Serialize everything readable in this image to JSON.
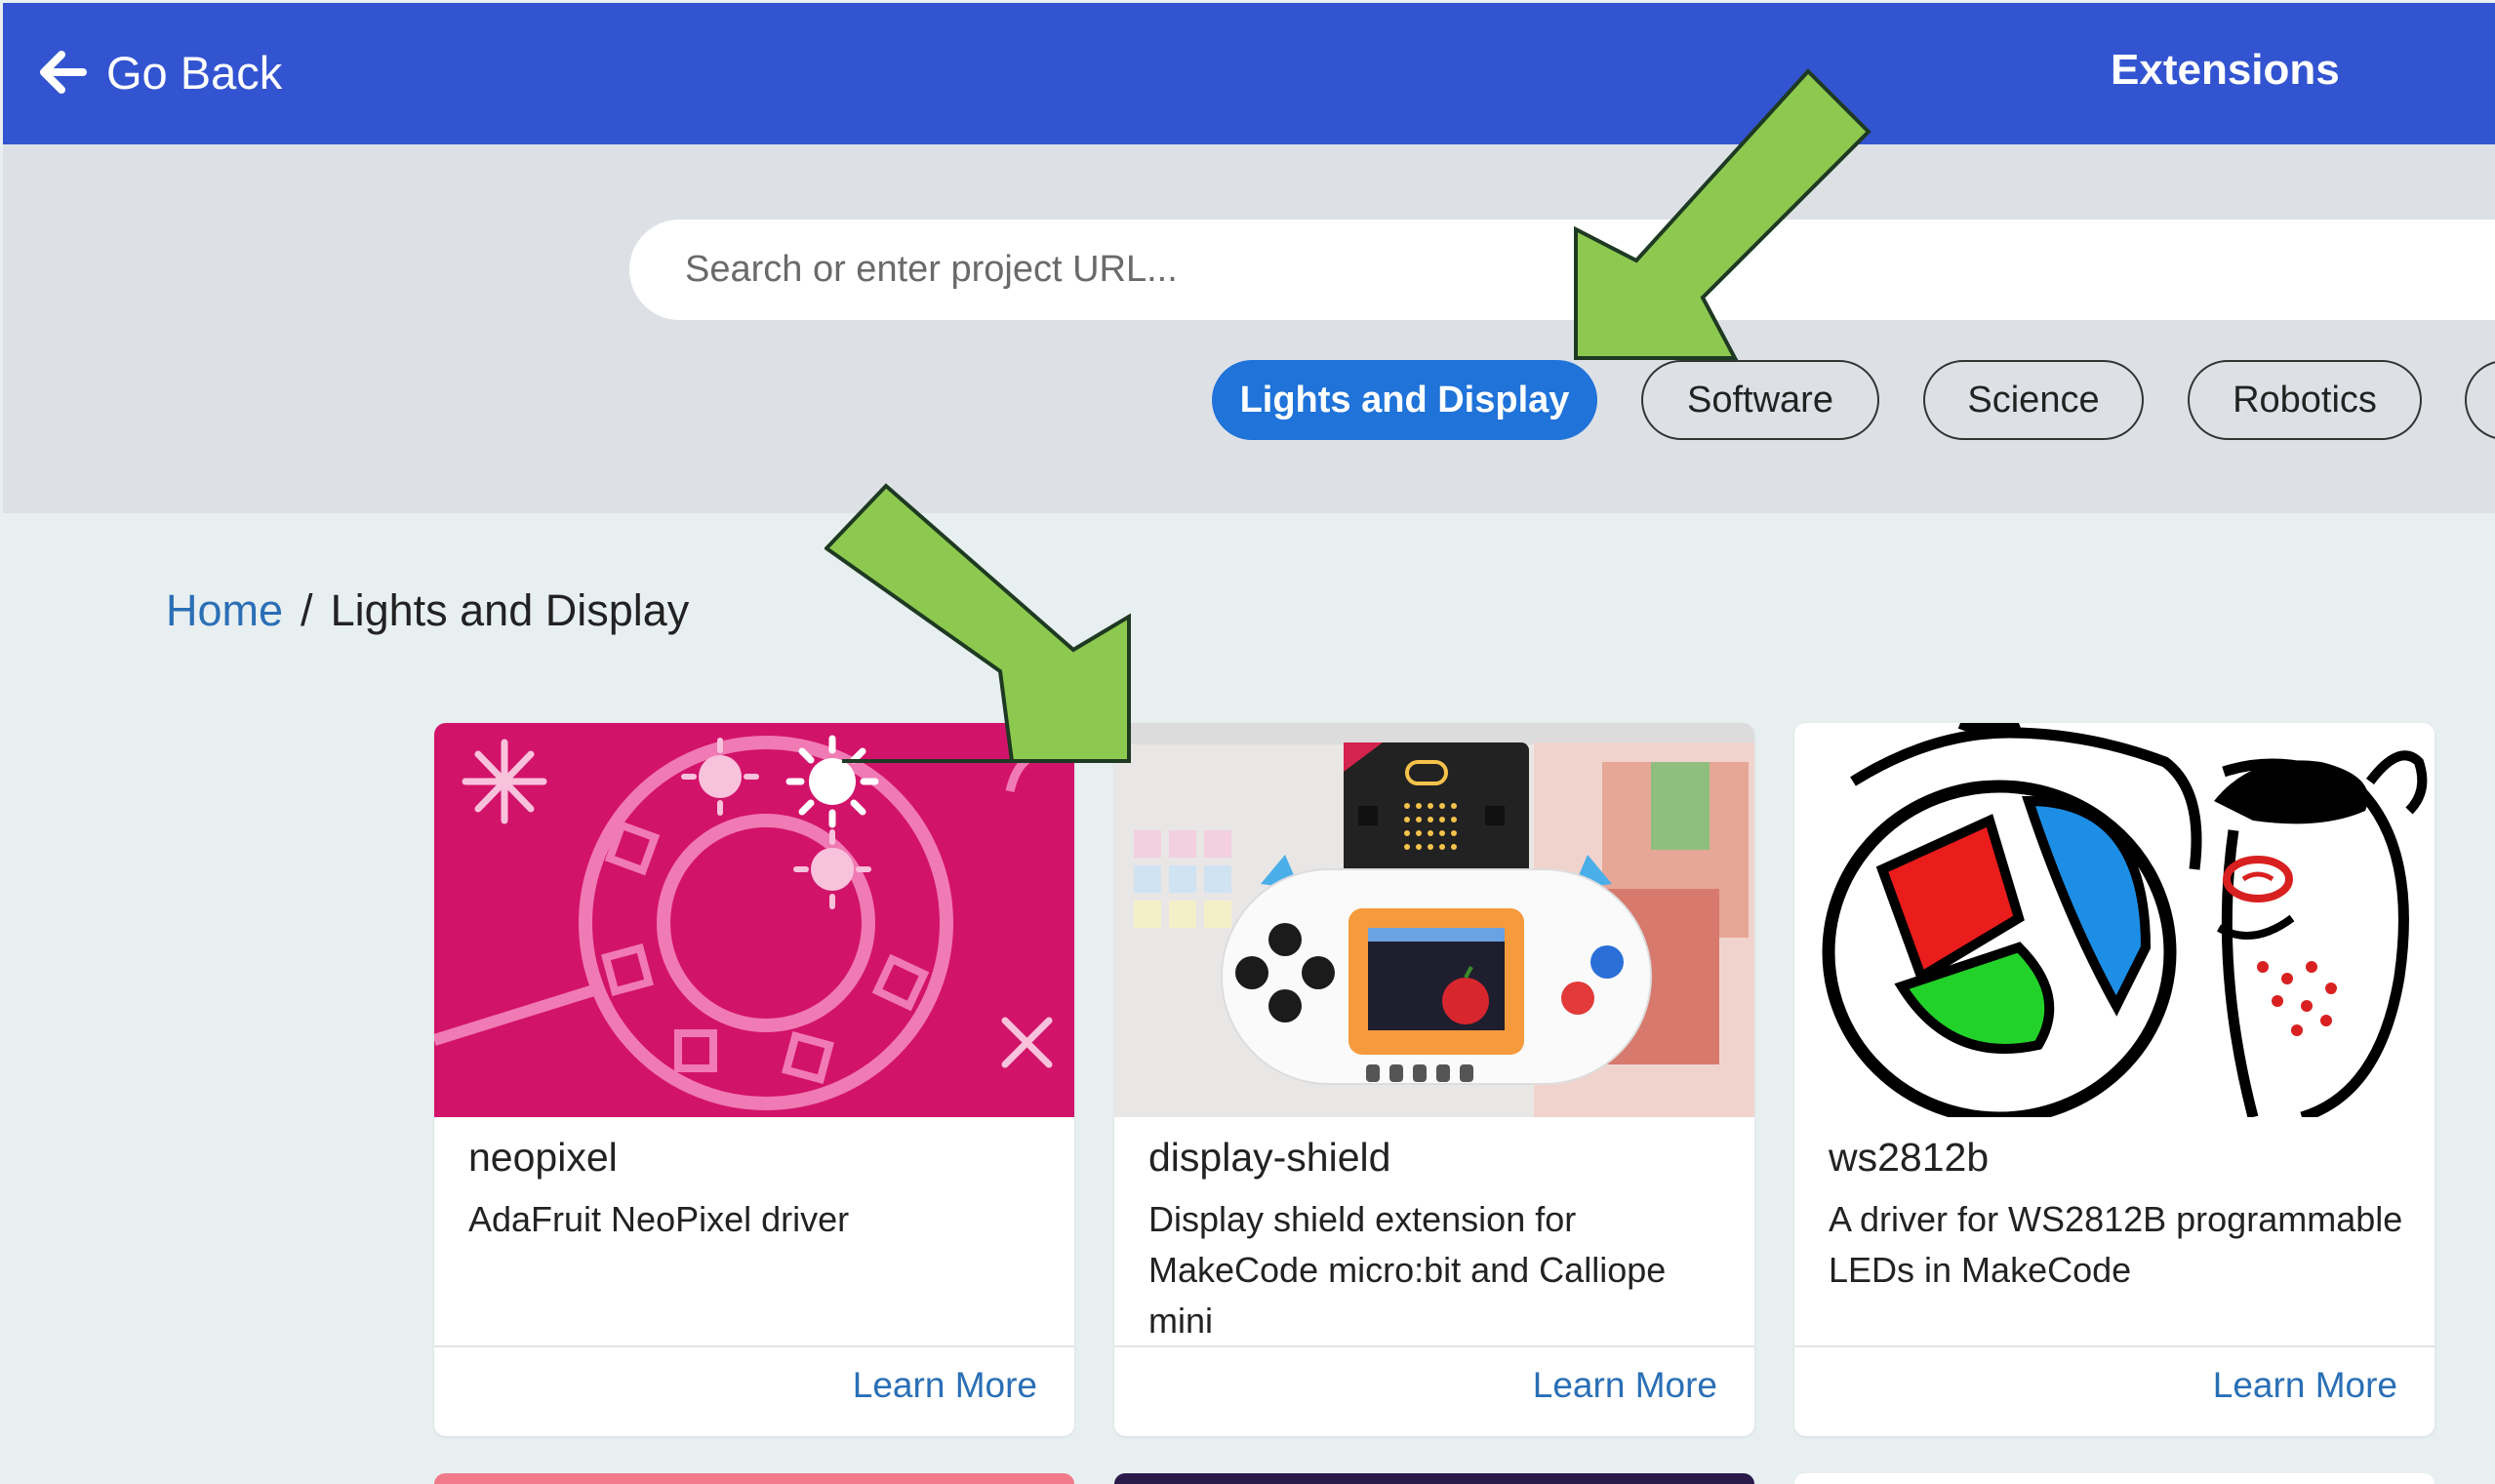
{
  "header": {
    "back_label": "Go Back",
    "title": "Extensions",
    "background": "#3354d1"
  },
  "search": {
    "placeholder": "Search or enter project URL..."
  },
  "categories": [
    {
      "label": "Lights and Display",
      "active": true
    },
    {
      "label": "Software",
      "active": false
    },
    {
      "label": "Science",
      "active": false
    },
    {
      "label": "Robotics",
      "active": false
    }
  ],
  "breadcrumb": {
    "home": "Home",
    "separator": "/",
    "current": "Lights and Display"
  },
  "cards": [
    {
      "title": "neopixel",
      "description": "AdaFruit NeoPixel driver",
      "action": "Learn More",
      "image": "neopixel-ring-illustration"
    },
    {
      "title": "display-shield",
      "description": "Display shield extension for MakeCode micro:bit and Calliope mini",
      "action": "Learn More",
      "image": "microbit-display-shield-photo"
    },
    {
      "title": "ws2812b",
      "description": "A driver for WS2812B programmable LEDs in MakeCode",
      "action": "Learn More",
      "image": "hand-drawn-led-cartoon"
    }
  ],
  "colors": {
    "accent": "#1f73d9",
    "link": "#2a6fb6",
    "annotation_arrow": "#8dc94f"
  },
  "icons": {
    "back": "arrow-left-icon"
  }
}
